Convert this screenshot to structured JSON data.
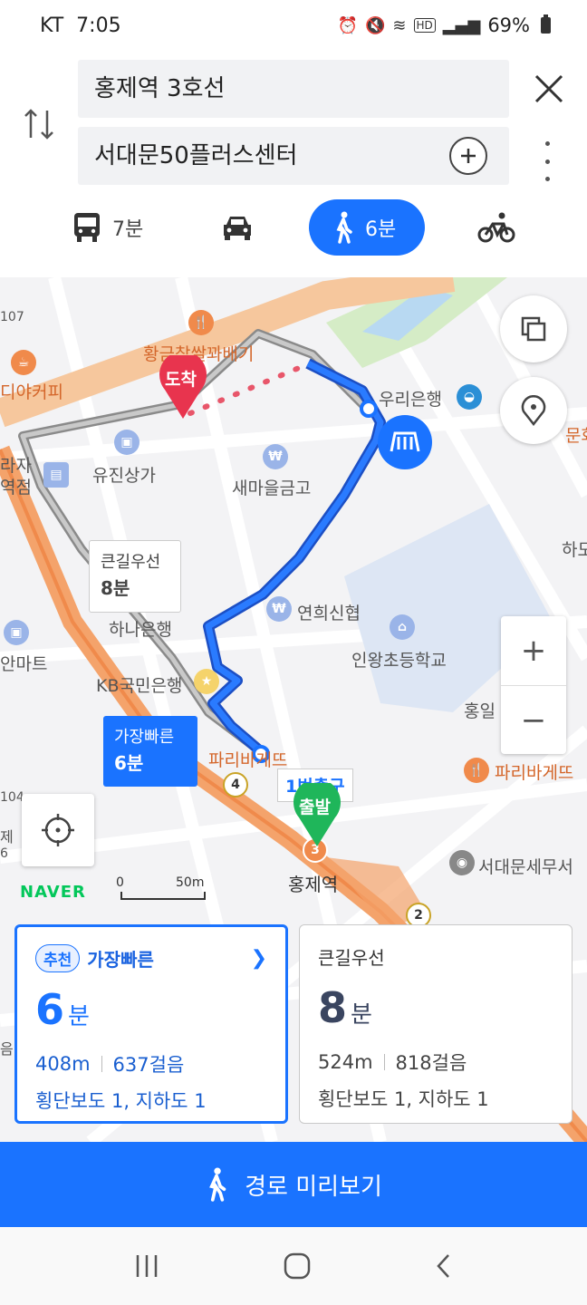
{
  "status": {
    "carrier": "KT",
    "time": "7:05",
    "battery": "69%"
  },
  "search": {
    "origin": "홍제역 3호선",
    "destination": "서대문50플러스센터"
  },
  "modes": [
    {
      "name": "bus",
      "label": "7분"
    },
    {
      "name": "car",
      "label": ""
    },
    {
      "name": "walk",
      "label": "6분"
    },
    {
      "name": "bike",
      "label": ""
    }
  ],
  "map": {
    "labels": {
      "l107": "107",
      "coffee": "디야커피",
      "rice": "황금찹쌀꽈배기",
      "woori": "우리은행",
      "munhwa": "문화",
      "yujin": "유진상가",
      "saemaul": "새마을금고",
      "rajaStation": "라자역점",
      "hado": "하도",
      "yeonhui": "연희신협",
      "hana": "하나은행",
      "inwang": "인왕초등학교",
      "antmart": "안마트",
      "kb": "KB국민은행",
      "hongil": "홍일",
      "paris1": "파리바게뜨",
      "paris2": "파리바게뜨",
      "exit1": "1번출구",
      "l104": "104",
      "hongjeStation": "홍제역",
      "taxOffice": "서대문세무서",
      "e6": "6",
      "eLetter": "음",
      "jeLetter": "제"
    },
    "arrival": "도착",
    "departure": "출발",
    "exit_num_4": "4",
    "exit_num_2": "2",
    "line_num": "3",
    "naver": "NAVER",
    "scale_zero": "0",
    "scale_label": "50m",
    "callout_main": {
      "title": "큰길우선",
      "time": "8분"
    },
    "callout_fast": {
      "title": "가장빠른",
      "time": "6분"
    }
  },
  "routes": [
    {
      "badge": "추천",
      "title": "가장빠른",
      "time_value": "6",
      "time_unit": "분",
      "distance": "408m",
      "steps": "637걸음",
      "detail": "횡단보도 1, 지하도 1"
    },
    {
      "badge": "",
      "title": "큰길우선",
      "time_value": "8",
      "time_unit": "분",
      "distance": "524m",
      "steps": "818걸음",
      "detail": "횡단보도 1, 지하도 1"
    }
  ],
  "preview_label": "경로 미리보기",
  "colors": {
    "accent": "#1a73ff",
    "arrival": "#e8344e",
    "departure": "#1fb65a",
    "subway_line": "#f08a4b"
  }
}
